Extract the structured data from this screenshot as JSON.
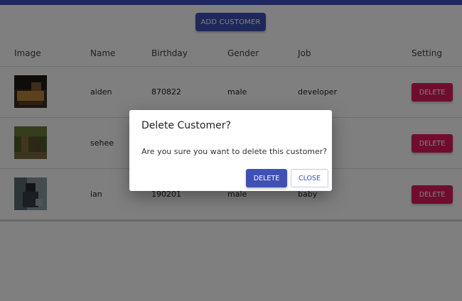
{
  "toolbar": {
    "add_label": "ADD CUSTOMER"
  },
  "table": {
    "headers": [
      "Image",
      "Name",
      "Birthday",
      "Gender",
      "Job",
      "Setting"
    ],
    "rows": [
      {
        "name": "aiden",
        "birthday": "870822",
        "gender": "male",
        "job": "developer",
        "action": "DELETE"
      },
      {
        "name": "sehee",
        "birthday": "",
        "gender": "",
        "job": "esigner",
        "action": "DELETE"
      },
      {
        "name": "ian",
        "birthday": "190201",
        "gender": "male",
        "job": "baby",
        "action": "DELETE"
      }
    ]
  },
  "dialog": {
    "title": "Delete Customer?",
    "message": "Are you sure you want to delete this customer?",
    "delete_label": "DELETE",
    "close_label": "CLOSE"
  },
  "colors": {
    "primary": "#3f51b5",
    "danger": "#e01a5f"
  }
}
